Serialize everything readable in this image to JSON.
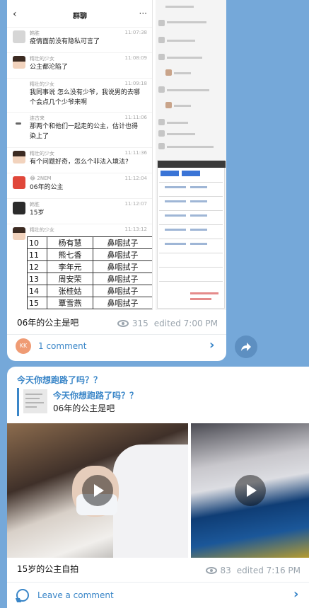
{
  "post1": {
    "image": {
      "chat_title": "群聊",
      "messages": [
        {
          "nick": "韩胜",
          "time": "11:07:38",
          "text": "疫情面前没有隐私可言了"
        },
        {
          "nick": "精壮的少女",
          "time": "11:08:09",
          "text": "公主都沦陷了"
        },
        {
          "nick": "精壮的少女",
          "time": "11:09:18",
          "text": "我同事说 怎么没有少爷，我说男的去哪个会点几个少爷来啊"
        },
        {
          "nick": "连古来",
          "time": "11:11:06",
          "text": "那两个和他们一起走的公主，估计也得染上了"
        },
        {
          "nick": "精壮的少女",
          "time": "11:11:36",
          "text": "有个问题好奇，怎么个非法入境法?"
        },
        {
          "nick": "😂 2NEM",
          "time": "11:12:04",
          "text": "06年的公主"
        },
        {
          "nick": "韩胜",
          "time": "11:12:07",
          "text": "15岁"
        },
        {
          "nick": "精壮的少女",
          "time": "11:13:12",
          "text": ""
        }
      ],
      "sheet_rows": [
        {
          "n": "10",
          "name": "杨有慧",
          "status": "鼻咽拭子"
        },
        {
          "n": "11",
          "name": "熊七香",
          "status": "鼻咽拭子"
        },
        {
          "n": "12",
          "name": "李年元",
          "status": "鼻咽拭子"
        },
        {
          "n": "13",
          "name": "周安荣",
          "status": "鼻咽拭子"
        },
        {
          "n": "14",
          "name": "张桂姑",
          "status": "鼻咽拭子"
        },
        {
          "n": "15",
          "name": "覃雪燕",
          "status": "鼻咽拭子"
        }
      ]
    },
    "caption": "06年的公主是吧",
    "views": "315",
    "edited": "edited 7:00 PM",
    "commenter_initials": "KK",
    "comment_label": "1 comment"
  },
  "post2": {
    "title": "今天你想跑路了吗？？",
    "reply_title": "今天你想跑路了吗？？",
    "reply_text": "06年的公主是吧",
    "caption": "15岁的公主自拍",
    "views": "83",
    "edited": "edited 7:16 PM",
    "comment_label": "Leave a comment"
  },
  "colors": {
    "background": "#75a8d9",
    "accent": "#3a86c8",
    "avatar_kk": "#ef9b74"
  }
}
